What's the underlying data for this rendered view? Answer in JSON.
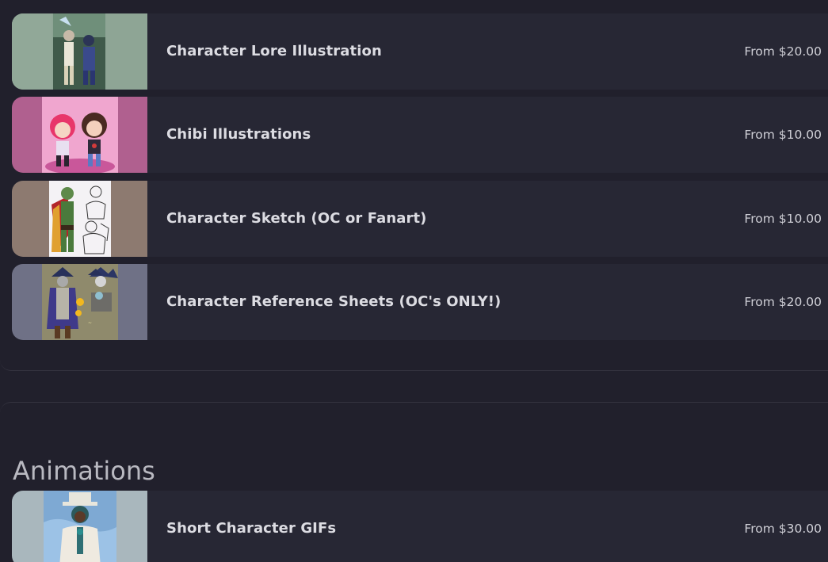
{
  "section_heading": "Animations",
  "items": [
    {
      "title": "Character Lore Illustration",
      "price": "From $20.00",
      "thumbnail": "character-lore-illustration-thumbnail"
    },
    {
      "title": "Chibi Illustrations",
      "price": "From $10.00",
      "thumbnail": "chibi-illustrations-thumbnail"
    },
    {
      "title": "Character Sketch (OC or Fanart)",
      "price": "From $10.00",
      "thumbnail": "character-sketch-thumbnail"
    },
    {
      "title": "Character Reference Sheets (OC's ONLY!)",
      "price": "From $20.00",
      "thumbnail": "character-reference-sheet-thumbnail"
    }
  ],
  "animation_items": [
    {
      "title": "Short Character GIFs",
      "price": "From $30.00",
      "thumbnail": "short-character-gif-thumbnail"
    }
  ]
}
